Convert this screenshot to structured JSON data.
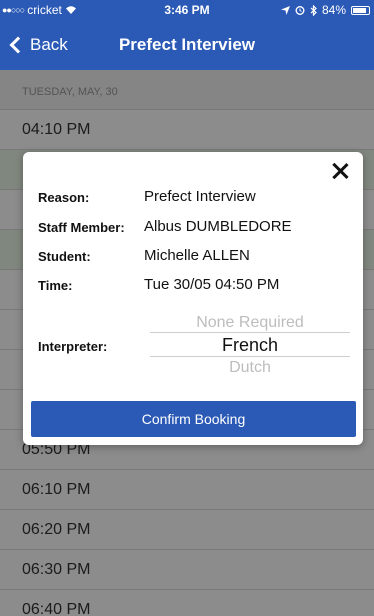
{
  "status_bar": {
    "signal_dots": "●●○○○",
    "carrier": "cricket",
    "wifi_icon": "wifi-icon",
    "time": "3:46 PM",
    "location_icon": "location-arrow-icon",
    "alarm_icon": "alarm-icon",
    "bluetooth_icon": "bluetooth-icon",
    "battery": "84%"
  },
  "nav": {
    "back_label": "Back",
    "title": "Prefect Interview"
  },
  "list": {
    "section_header": "TUESDAY, MAY, 30",
    "slots": [
      "04:10 PM",
      "05:50 PM",
      "06:10 PM",
      "06:20 PM",
      "06:30 PM",
      "06:40 PM"
    ]
  },
  "modal": {
    "reason_label": "Reason:",
    "reason_value": "Prefect Interview",
    "staff_label": "Staff Member:",
    "staff_value": "Albus DUMBLEDORE",
    "student_label": "Student:",
    "student_value": "Michelle ALLEN",
    "time_label": "Time:",
    "time_value": "Tue 30/05 04:50 PM",
    "interpreter_label": "Interpreter:",
    "interpreter_options": [
      "None Required",
      "French",
      "Dutch"
    ],
    "interpreter_selected": "French",
    "confirm_label": "Confirm Booking"
  },
  "colors": {
    "primary": "#2b59b6",
    "overlay": "rgba(0,0,0,0.45)",
    "available_slot_tint": "#eaf6e6"
  }
}
